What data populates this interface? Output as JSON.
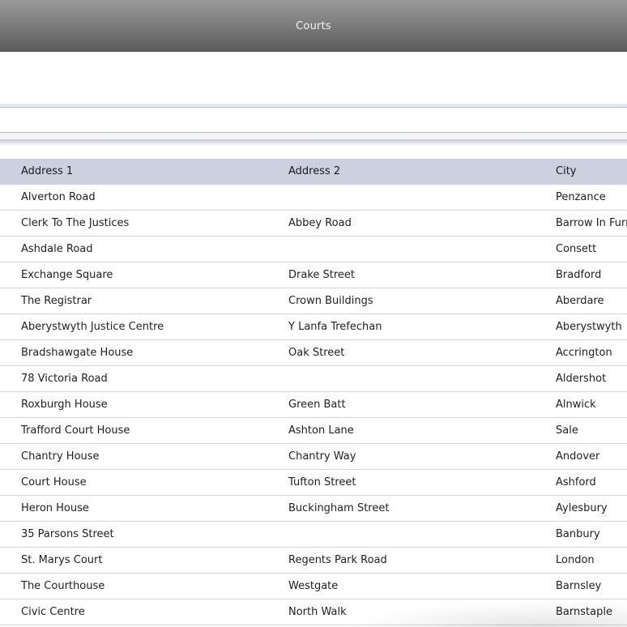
{
  "window": {
    "title": "Courts"
  },
  "search": {
    "value": "",
    "placeholder": ""
  },
  "table": {
    "columns": [
      "Address 1",
      "Address 2",
      "City"
    ],
    "rows": [
      [
        "Alverton Road",
        "",
        "Penzance"
      ],
      [
        "Clerk To The Justices",
        "Abbey Road",
        "Barrow In Furness"
      ],
      [
        "Ashdale Road",
        "",
        "Consett"
      ],
      [
        "Exchange Square",
        "Drake Street",
        "Bradford"
      ],
      [
        "The Registrar",
        "Crown Buildings",
        "Aberdare"
      ],
      [
        "Aberystwyth Justice Centre",
        "Y Lanfa Trefechan",
        "Aberystwyth"
      ],
      [
        "Bradshawgate House",
        "Oak Street",
        "Accrington"
      ],
      [
        "78 Victoria Road",
        "",
        "Aldershot"
      ],
      [
        "Roxburgh House",
        "Green Batt",
        "Alnwick"
      ],
      [
        "Trafford Court House",
        "Ashton Lane",
        "Sale"
      ],
      [
        "Chantry House",
        "Chantry Way",
        "Andover"
      ],
      [
        "Court House",
        "Tufton Street",
        "Ashford"
      ],
      [
        "Heron House",
        "Buckingham Street",
        "Aylesbury"
      ],
      [
        "35 Parsons Street",
        "",
        "Banbury"
      ],
      [
        "St. Marys Court",
        "Regents Park Road",
        "London"
      ],
      [
        "The Courthouse",
        "Westgate",
        "Barnsley"
      ],
      [
        "Civic Centre",
        "North Walk",
        "Barnstaple"
      ]
    ]
  },
  "colors": {
    "title_bar": "#7e7e7e",
    "header_row": "#cdd1df",
    "row_divider": "#d4d4d4"
  }
}
